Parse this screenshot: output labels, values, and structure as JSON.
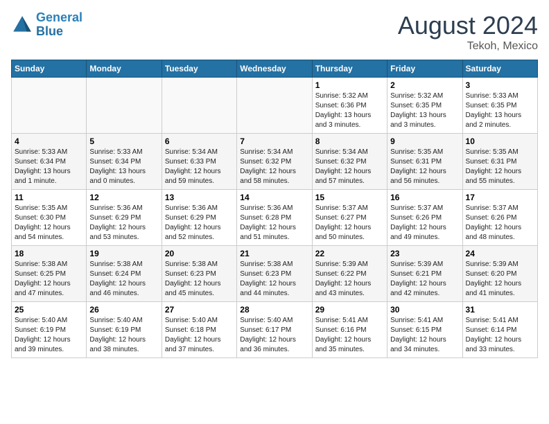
{
  "header": {
    "logo_line1": "General",
    "logo_line2": "Blue",
    "month": "August 2024",
    "location": "Tekoh, Mexico"
  },
  "weekdays": [
    "Sunday",
    "Monday",
    "Tuesday",
    "Wednesday",
    "Thursday",
    "Friday",
    "Saturday"
  ],
  "weeks": [
    [
      {
        "day": "",
        "info": ""
      },
      {
        "day": "",
        "info": ""
      },
      {
        "day": "",
        "info": ""
      },
      {
        "day": "",
        "info": ""
      },
      {
        "day": "1",
        "info": "Sunrise: 5:32 AM\nSunset: 6:36 PM\nDaylight: 13 hours\nand 3 minutes."
      },
      {
        "day": "2",
        "info": "Sunrise: 5:32 AM\nSunset: 6:35 PM\nDaylight: 13 hours\nand 3 minutes."
      },
      {
        "day": "3",
        "info": "Sunrise: 5:33 AM\nSunset: 6:35 PM\nDaylight: 13 hours\nand 2 minutes."
      }
    ],
    [
      {
        "day": "4",
        "info": "Sunrise: 5:33 AM\nSunset: 6:34 PM\nDaylight: 13 hours\nand 1 minute."
      },
      {
        "day": "5",
        "info": "Sunrise: 5:33 AM\nSunset: 6:34 PM\nDaylight: 13 hours\nand 0 minutes."
      },
      {
        "day": "6",
        "info": "Sunrise: 5:34 AM\nSunset: 6:33 PM\nDaylight: 12 hours\nand 59 minutes."
      },
      {
        "day": "7",
        "info": "Sunrise: 5:34 AM\nSunset: 6:32 PM\nDaylight: 12 hours\nand 58 minutes."
      },
      {
        "day": "8",
        "info": "Sunrise: 5:34 AM\nSunset: 6:32 PM\nDaylight: 12 hours\nand 57 minutes."
      },
      {
        "day": "9",
        "info": "Sunrise: 5:35 AM\nSunset: 6:31 PM\nDaylight: 12 hours\nand 56 minutes."
      },
      {
        "day": "10",
        "info": "Sunrise: 5:35 AM\nSunset: 6:31 PM\nDaylight: 12 hours\nand 55 minutes."
      }
    ],
    [
      {
        "day": "11",
        "info": "Sunrise: 5:35 AM\nSunset: 6:30 PM\nDaylight: 12 hours\nand 54 minutes."
      },
      {
        "day": "12",
        "info": "Sunrise: 5:36 AM\nSunset: 6:29 PM\nDaylight: 12 hours\nand 53 minutes."
      },
      {
        "day": "13",
        "info": "Sunrise: 5:36 AM\nSunset: 6:29 PM\nDaylight: 12 hours\nand 52 minutes."
      },
      {
        "day": "14",
        "info": "Sunrise: 5:36 AM\nSunset: 6:28 PM\nDaylight: 12 hours\nand 51 minutes."
      },
      {
        "day": "15",
        "info": "Sunrise: 5:37 AM\nSunset: 6:27 PM\nDaylight: 12 hours\nand 50 minutes."
      },
      {
        "day": "16",
        "info": "Sunrise: 5:37 AM\nSunset: 6:26 PM\nDaylight: 12 hours\nand 49 minutes."
      },
      {
        "day": "17",
        "info": "Sunrise: 5:37 AM\nSunset: 6:26 PM\nDaylight: 12 hours\nand 48 minutes."
      }
    ],
    [
      {
        "day": "18",
        "info": "Sunrise: 5:38 AM\nSunset: 6:25 PM\nDaylight: 12 hours\nand 47 minutes."
      },
      {
        "day": "19",
        "info": "Sunrise: 5:38 AM\nSunset: 6:24 PM\nDaylight: 12 hours\nand 46 minutes."
      },
      {
        "day": "20",
        "info": "Sunrise: 5:38 AM\nSunset: 6:23 PM\nDaylight: 12 hours\nand 45 minutes."
      },
      {
        "day": "21",
        "info": "Sunrise: 5:38 AM\nSunset: 6:23 PM\nDaylight: 12 hours\nand 44 minutes."
      },
      {
        "day": "22",
        "info": "Sunrise: 5:39 AM\nSunset: 6:22 PM\nDaylight: 12 hours\nand 43 minutes."
      },
      {
        "day": "23",
        "info": "Sunrise: 5:39 AM\nSunset: 6:21 PM\nDaylight: 12 hours\nand 42 minutes."
      },
      {
        "day": "24",
        "info": "Sunrise: 5:39 AM\nSunset: 6:20 PM\nDaylight: 12 hours\nand 41 minutes."
      }
    ],
    [
      {
        "day": "25",
        "info": "Sunrise: 5:40 AM\nSunset: 6:19 PM\nDaylight: 12 hours\nand 39 minutes."
      },
      {
        "day": "26",
        "info": "Sunrise: 5:40 AM\nSunset: 6:19 PM\nDaylight: 12 hours\nand 38 minutes."
      },
      {
        "day": "27",
        "info": "Sunrise: 5:40 AM\nSunset: 6:18 PM\nDaylight: 12 hours\nand 37 minutes."
      },
      {
        "day": "28",
        "info": "Sunrise: 5:40 AM\nSunset: 6:17 PM\nDaylight: 12 hours\nand 36 minutes."
      },
      {
        "day": "29",
        "info": "Sunrise: 5:41 AM\nSunset: 6:16 PM\nDaylight: 12 hours\nand 35 minutes."
      },
      {
        "day": "30",
        "info": "Sunrise: 5:41 AM\nSunset: 6:15 PM\nDaylight: 12 hours\nand 34 minutes."
      },
      {
        "day": "31",
        "info": "Sunrise: 5:41 AM\nSunset: 6:14 PM\nDaylight: 12 hours\nand 33 minutes."
      }
    ]
  ]
}
